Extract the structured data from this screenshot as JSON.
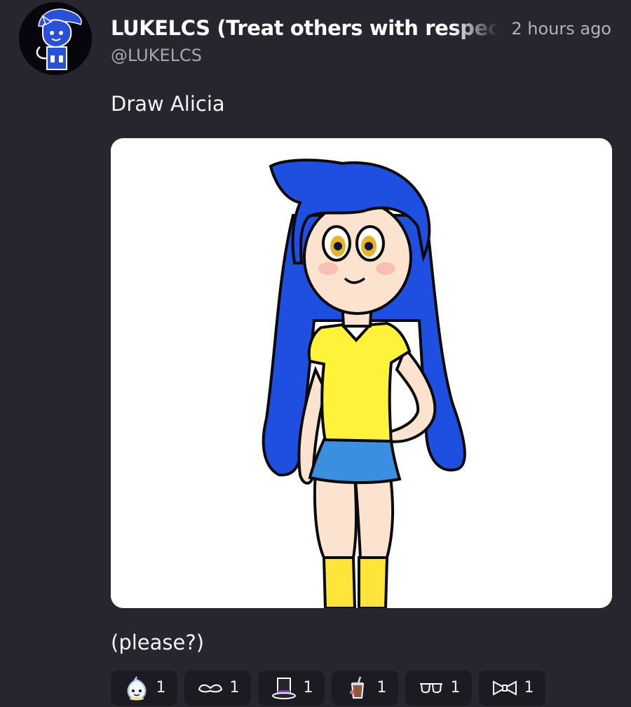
{
  "post": {
    "author": {
      "display_name": "LUKELCS (Treat others with respect, be kind and inclusive)",
      "handle": "@LUKELCS",
      "avatar_icon": "cat-character-avatar-icon"
    },
    "timestamp": "2 hours ago",
    "text_above": "Draw Alicia",
    "text_below": "(please?)",
    "image": {
      "description_icon": "alicia-drawing"
    },
    "reactions": [
      {
        "icon": "onion-ghost-icon",
        "count": "1"
      },
      {
        "icon": "mustache-icon",
        "count": "1"
      },
      {
        "icon": "top-hat-icon",
        "count": "1"
      },
      {
        "icon": "drink-cup-icon",
        "count": "1"
      },
      {
        "icon": "sunglasses-icon",
        "count": "1"
      },
      {
        "icon": "bowtie-icon",
        "count": "1"
      }
    ]
  },
  "colors": {
    "background": "#27252e",
    "reaction_bg": "#1c1b21",
    "hair_blue": "#1f4fe0",
    "shirt_yellow": "#fff23a",
    "skirt_blue": "#3a8fe0"
  }
}
